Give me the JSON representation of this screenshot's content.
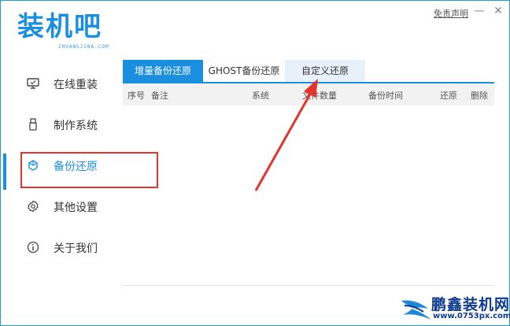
{
  "app": {
    "logo_text": "装机吧",
    "logo_sub": "ZHUANGJIBA.COM",
    "disclaimer": "免责声明"
  },
  "window_controls": {
    "minimize": "—",
    "close": "✕"
  },
  "sidebar": {
    "items": [
      {
        "label": "在线重装",
        "icon": "monitor-icon",
        "active": false
      },
      {
        "label": "制作系统",
        "icon": "usb-icon",
        "active": false
      },
      {
        "label": "备份还原",
        "icon": "backup-icon",
        "active": true
      },
      {
        "label": "其他设置",
        "icon": "gear-icon",
        "active": false
      },
      {
        "label": "关于我们",
        "icon": "info-icon",
        "active": false
      }
    ]
  },
  "tabs": [
    {
      "label": "增量备份还原",
      "active": true
    },
    {
      "label": "GHOST备份还原",
      "active": false
    },
    {
      "label": "自定义还原",
      "active": false
    }
  ],
  "table": {
    "columns": [
      "序号",
      "备注",
      "系统",
      "文件数量",
      "备份时间",
      "还原",
      "删除"
    ],
    "rows": []
  },
  "watermark": {
    "title": "鹏鑫装机网",
    "url": "www.0753px.com"
  },
  "colors": {
    "accent": "#1a8fe0",
    "highlight": "#e5322d",
    "watermark": "#0f3b91"
  }
}
